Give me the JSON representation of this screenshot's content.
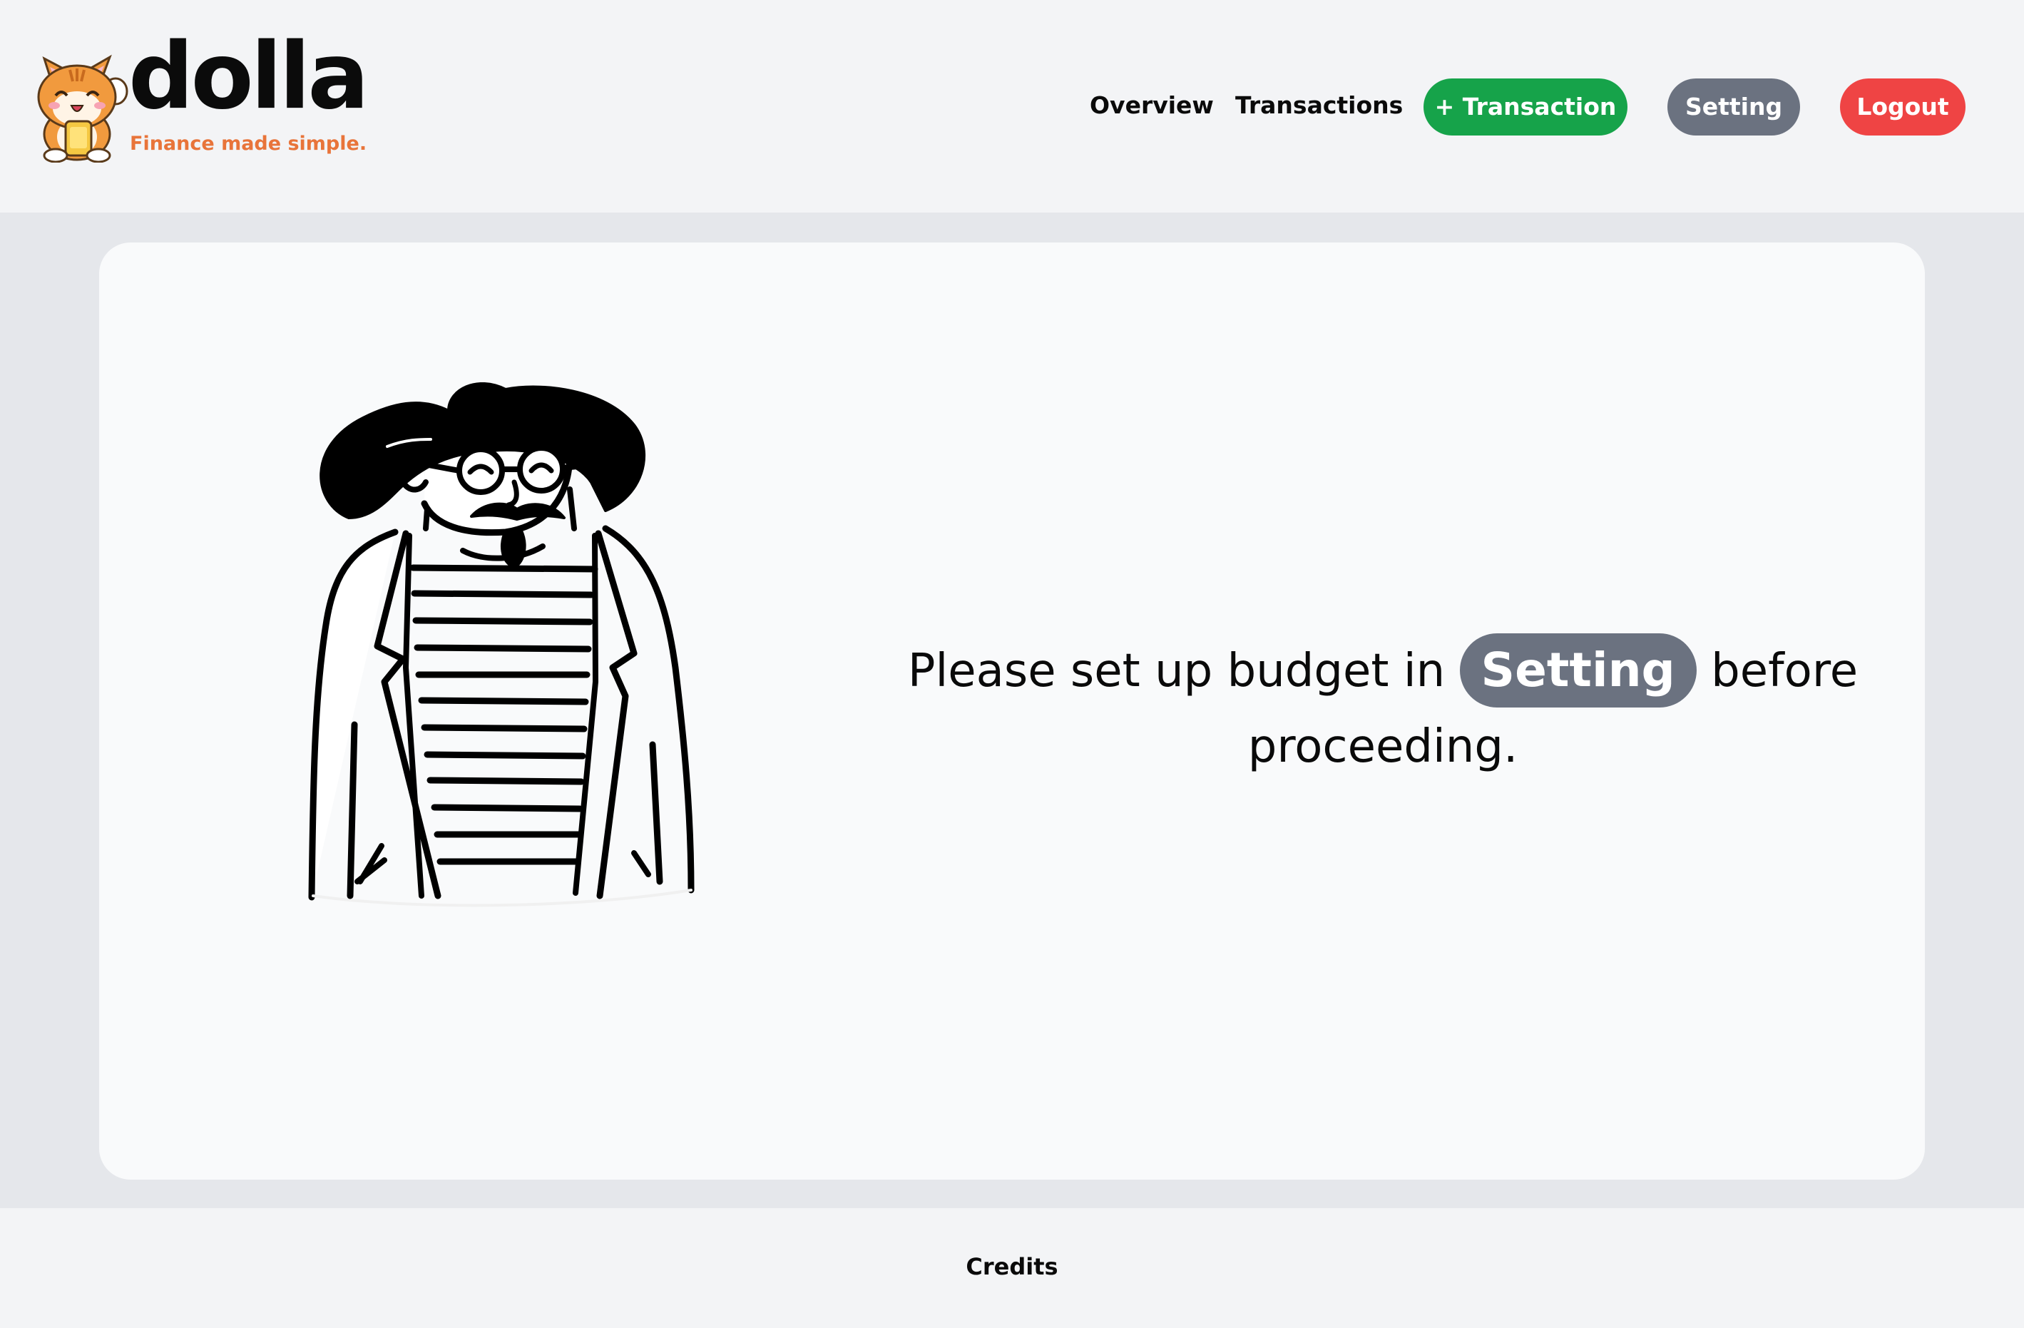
{
  "brand": {
    "name": "dolla",
    "tagline": "Finance made simple.",
    "tagline_color": "#e8743a"
  },
  "nav": {
    "overview_label": "Overview",
    "transactions_label": "Transactions",
    "add_transaction_label": "+ Transaction",
    "setting_label": "Setting",
    "logout_label": "Logout"
  },
  "colors": {
    "add_button": "#16a34a",
    "setting_button": "#6b7280",
    "logout_button": "#ef4444",
    "page_background": "#e5e7eb",
    "card_background": "#f9fafb"
  },
  "main": {
    "message_before": "Please set up budget in ",
    "message_link": "Setting",
    "message_after": " before proceeding.",
    "illustration_icon": "man-with-hat-illustration"
  },
  "footer": {
    "credits_label": "Credits"
  }
}
